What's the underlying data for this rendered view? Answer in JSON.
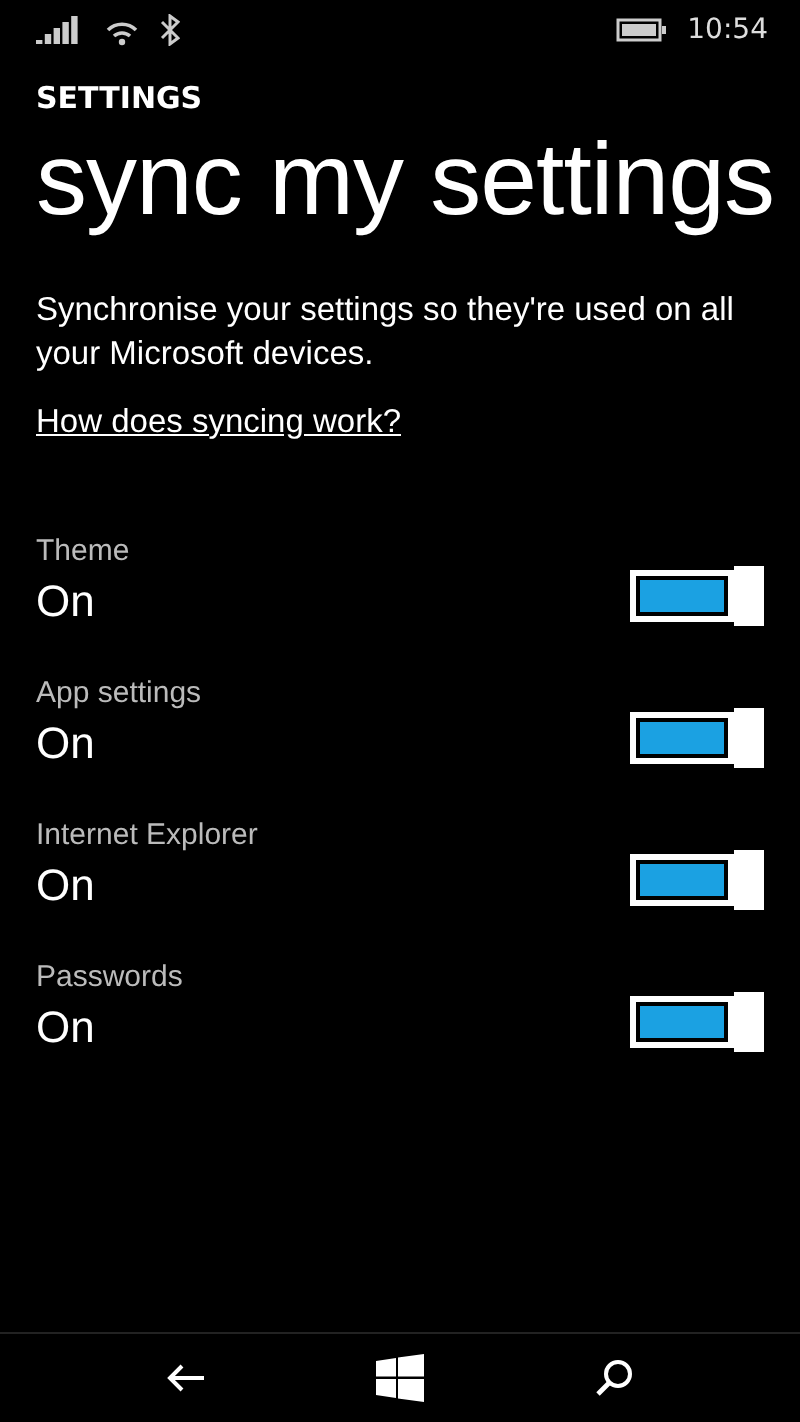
{
  "status_bar": {
    "time": "10:54"
  },
  "header": {
    "section": "SETTINGS",
    "title": "sync my settings"
  },
  "description": "Synchronise your settings so they're used on all your Microsoft devices.",
  "help_link": "How does syncing work?",
  "toggles": [
    {
      "label": "Theme",
      "value": "On",
      "on": true
    },
    {
      "label": "App settings",
      "value": "On",
      "on": true
    },
    {
      "label": "Internet Explorer",
      "value": "On",
      "on": true
    },
    {
      "label": "Passwords",
      "value": "On",
      "on": true
    }
  ]
}
